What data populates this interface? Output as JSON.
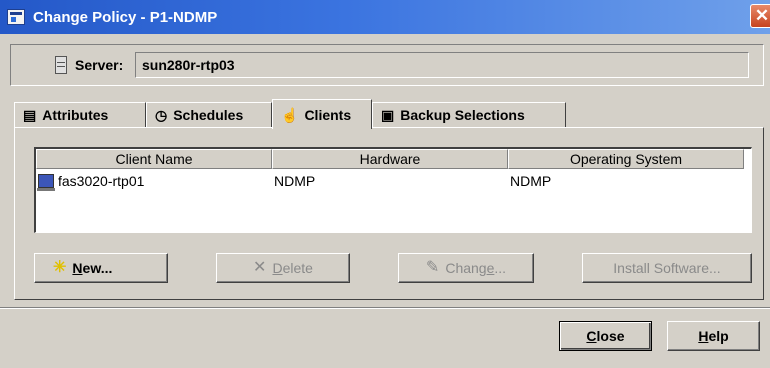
{
  "window": {
    "title": "Change Policy - P1-NDMP",
    "close_glyph": "✕"
  },
  "server": {
    "label": "Server:",
    "value": "sun280r-rtp03"
  },
  "tabs": [
    {
      "label": "Attributes",
      "icon": "list-icon",
      "active": false
    },
    {
      "label": "Schedules",
      "icon": "clock-icon",
      "active": false
    },
    {
      "label": "Clients",
      "icon": "cursor-icon",
      "active": true
    },
    {
      "label": "Backup Selections",
      "icon": "document-icon",
      "active": false
    }
  ],
  "clients_table": {
    "columns": [
      "Client Name",
      "Hardware",
      "Operating System"
    ],
    "rows": [
      {
        "client_name": "fas3020-rtp01",
        "hardware": "NDMP",
        "operating_system": "NDMP"
      }
    ]
  },
  "actions": {
    "new_mnemonic": "N",
    "new_rest": "ew...",
    "delete_mnemonic": "D",
    "delete_rest": "elete",
    "change_prefix": "Chang",
    "change_mnemonic": "e",
    "change_suffix": "...",
    "install_label": "Install Software..."
  },
  "dialog_buttons": {
    "close_mnemonic": "C",
    "close_rest": "lose",
    "help_mnemonic": "H",
    "help_rest": "elp"
  },
  "colors": {
    "titlebar_start": "#2458c8",
    "titlebar_end": "#6fa0ea",
    "dialog_background": "#d4d0c8",
    "disabled_text": "#8a8a8a"
  }
}
